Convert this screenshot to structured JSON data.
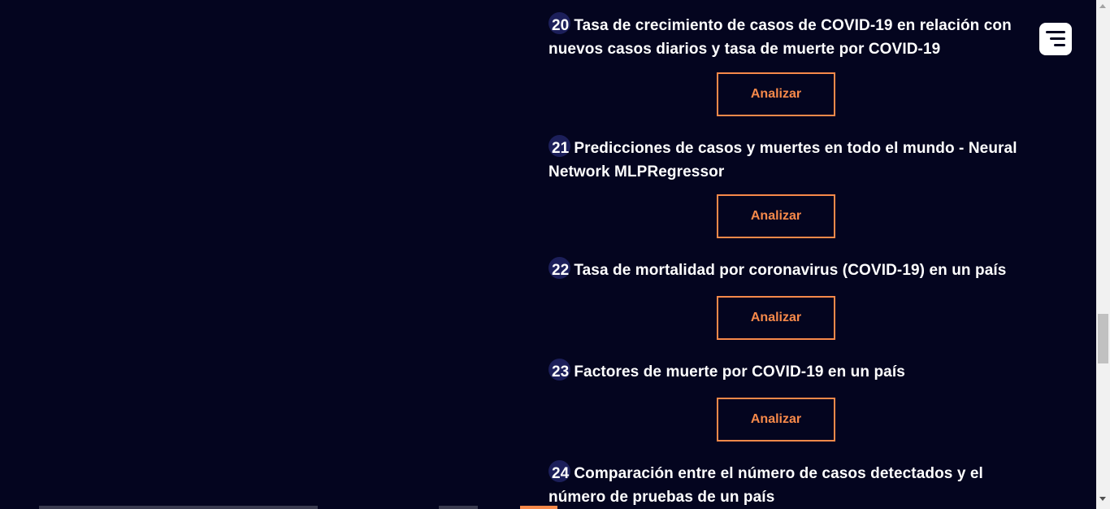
{
  "items": [
    {
      "number": "20",
      "title": "Tasa de crecimiento de casos de COVID-19 en relación con nuevos casos diarios y tasa de muerte por COVID-19",
      "button": "Analizar"
    },
    {
      "number": "21",
      "title": "Predicciones de casos y muertes en todo el mundo - Neural Network MLPRegressor",
      "button": "Analizar"
    },
    {
      "number": "22",
      "title": "Tasa de mortalidad por coronavirus (COVID-19) en un país",
      "button": "Analizar"
    },
    {
      "number": "23",
      "title": "Factores de muerte por COVID-19 en un país",
      "button": "Analizar"
    },
    {
      "number": "24",
      "title": "Comparación entre el número de casos detectados y el número de pruebas de un país"
    }
  ],
  "menu": {
    "icon": "hamburger-menu-icon"
  },
  "colors": {
    "background": "#04051f",
    "accent": "#f7894a",
    "number_badge": "#1c1f5a",
    "text": "#ffffff"
  }
}
